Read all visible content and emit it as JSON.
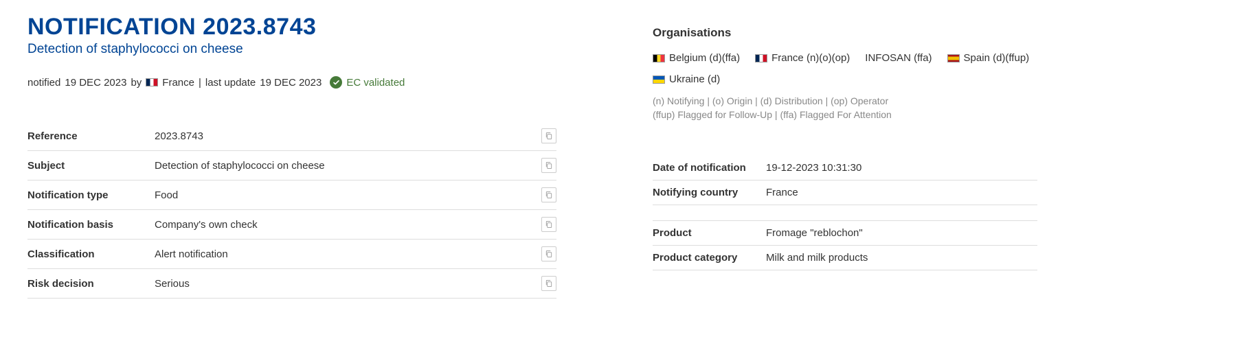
{
  "title": "NOTIFICATION 2023.8743",
  "subtitle": "Detection of staphylococci on cheese",
  "meta": {
    "notified_prefix": "notified",
    "notified_date": "19 DEC 2023",
    "by": "by",
    "notifier_country": "France",
    "last_update_prefix": "last update",
    "last_update_date": "19 DEC 2023",
    "validated_label": "EC validated"
  },
  "details": [
    {
      "label": "Reference",
      "value": "2023.8743"
    },
    {
      "label": "Subject",
      "value": "Detection of staphylococci on cheese"
    },
    {
      "label": "Notification type",
      "value": "Food"
    },
    {
      "label": "Notification basis",
      "value": "Company's own check"
    },
    {
      "label": "Classification",
      "value": "Alert notification"
    },
    {
      "label": "Risk decision",
      "value": "Serious"
    }
  ],
  "organisations": {
    "title": "Organisations",
    "items": [
      {
        "flag": "be",
        "text": "Belgium (d)(ffa)"
      },
      {
        "flag": "fr",
        "text": "France (n)(o)(op)"
      },
      {
        "flag": null,
        "text": "INFOSAN (ffa)"
      },
      {
        "flag": "es",
        "text": "Spain (d)(ffup)"
      },
      {
        "flag": "ua",
        "text": "Ukraine (d)"
      }
    ],
    "legend_line1": "(n) Notifying | (o) Origin | (d) Distribution | (op) Operator",
    "legend_line2": "(ffup) Flagged for Follow-Up | (ffa) Flagged For Attention"
  },
  "right_info": {
    "group1": [
      {
        "label": "Date of notification",
        "value": "19-12-2023 10:31:30"
      },
      {
        "label": "Notifying country",
        "value": "France"
      }
    ],
    "group2": [
      {
        "label": "Product",
        "value": "Fromage \"reblochon\""
      },
      {
        "label": "Product category",
        "value": "Milk and milk products"
      }
    ]
  }
}
